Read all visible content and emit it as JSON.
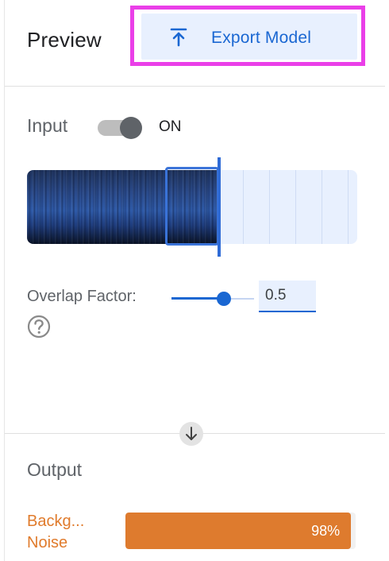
{
  "header": {
    "title": "Preview",
    "export_label": "Export Model",
    "export_icon": "upload-icon"
  },
  "input": {
    "label": "Input",
    "toggle_state": "ON",
    "toggle_on": true
  },
  "overlap": {
    "label": "Overlap Factor:",
    "value": "0.5",
    "slider_fraction": 0.5
  },
  "output": {
    "label": "Output",
    "results": [
      {
        "label": "Backg...\nNoise",
        "value_text": "98%",
        "fraction": 0.98
      }
    ]
  },
  "colors": {
    "accent_blue": "#1a67d2",
    "highlight_magenta": "#ea3fe8",
    "result_orange": "#de7b2e"
  },
  "icons": {
    "help": "help-circle-icon",
    "expand": "arrow-down-icon"
  }
}
